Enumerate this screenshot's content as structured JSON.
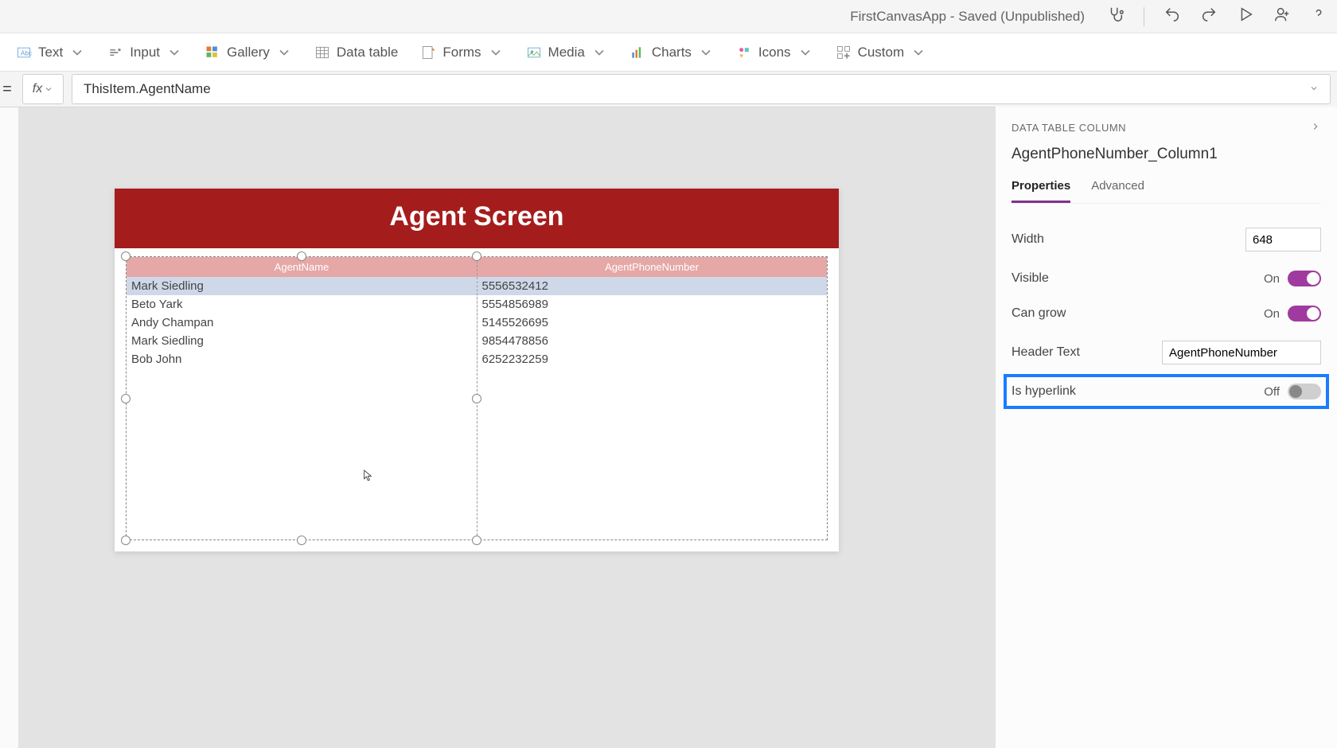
{
  "titlebar": {
    "app_title": "FirstCanvasApp - Saved (Unpublished)"
  },
  "ribbon": {
    "text": "Text",
    "input": "Input",
    "gallery": "Gallery",
    "datatable": "Data table",
    "forms": "Forms",
    "media": "Media",
    "charts": "Charts",
    "icons": "Icons",
    "custom": "Custom"
  },
  "formula": {
    "fx": "fx",
    "value": "ThisItem.AgentName"
  },
  "screen": {
    "header": "Agent Screen",
    "columns": [
      "AgentName",
      "AgentPhoneNumber"
    ],
    "rows": [
      {
        "name": "Mark Siedling",
        "phone": "5556532412"
      },
      {
        "name": "Beto Yark",
        "phone": "5554856989"
      },
      {
        "name": "Andy Champan",
        "phone": "5145526695"
      },
      {
        "name": "Mark Siedling",
        "phone": "9854478856"
      },
      {
        "name": "Bob John",
        "phone": "6252232259"
      }
    ]
  },
  "panel": {
    "section": "DATA TABLE COLUMN",
    "object_name": "AgentPhoneNumber_Column1",
    "tabs": {
      "properties": "Properties",
      "advanced": "Advanced"
    },
    "props": {
      "width_label": "Width",
      "width_value": "648",
      "visible_label": "Visible",
      "visible_state": "On",
      "cangrow_label": "Can grow",
      "cangrow_state": "On",
      "headertext_label": "Header Text",
      "headertext_value": "AgentPhoneNumber",
      "hyperlink_label": "Is hyperlink",
      "hyperlink_state": "Off"
    }
  }
}
